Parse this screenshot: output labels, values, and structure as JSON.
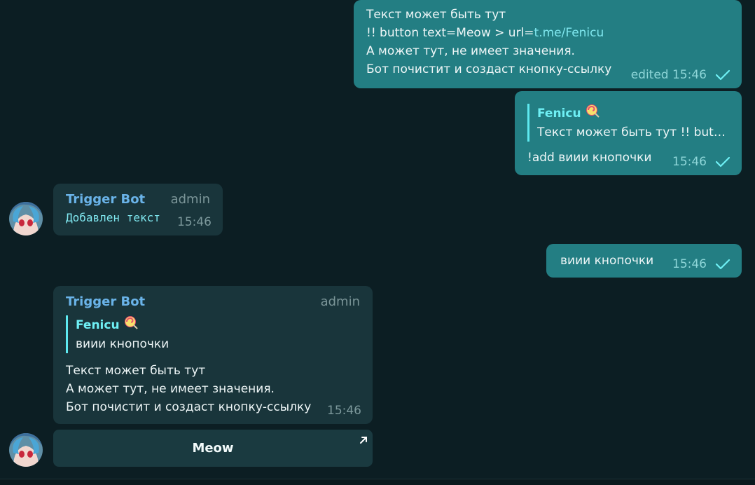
{
  "messages": {
    "m1": {
      "lines": [
        "Текст может быть тут",
        "!! button text=Meow > url=",
        "А может тут, не имеет значения.",
        "Бот почистит и создаст кнопку-ссылку"
      ],
      "link": "t.me/Fenicu",
      "meta": "edited 15:46"
    },
    "m2": {
      "quote_name": "Fenicu",
      "quote_text": "Текст может быть тут !! butt…",
      "text": "!add виии кнопочки",
      "time": "15:46"
    },
    "m3": {
      "sender": "Trigger Bot",
      "role": "admin",
      "text": "Добавлен текст",
      "time": "15:46"
    },
    "m4": {
      "text": "виии кнопочки",
      "time": "15:46"
    },
    "m5": {
      "sender": "Trigger Bot",
      "role": "admin",
      "quote_name": "Fenicu",
      "quote_text": "виии кнопочки",
      "lines": [
        "Текст может быть тут",
        "А может тут, не имеет значения.",
        "Бот почистит и создаст кнопку-ссылку"
      ],
      "time": "15:46",
      "button_label": "Meow"
    }
  },
  "icons": {
    "read_check": "check-icon",
    "emoji": "lollipop-icon",
    "inline_link": "arrow-up-right-icon"
  },
  "colors": {
    "background": "#0c1e23",
    "outgoing_bubble": "#237e83",
    "incoming_bubble": "#19353b",
    "accent": "#6ff0f5"
  }
}
